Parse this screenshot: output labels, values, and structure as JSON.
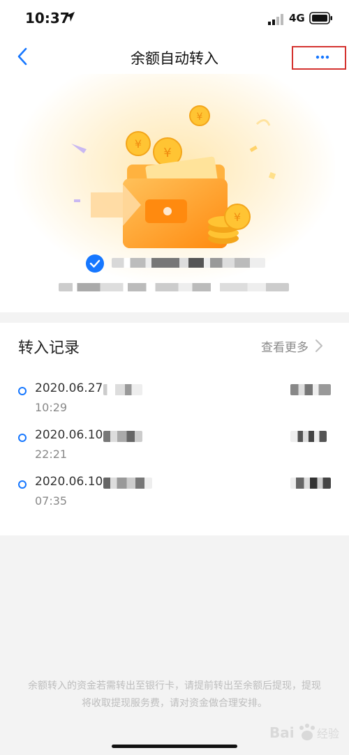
{
  "status_bar": {
    "time": "10:37",
    "network": "4G"
  },
  "nav": {
    "title": "余额自动转入",
    "back_icon": "chevron-left-icon",
    "more_icon": "more-horizontal-icon"
  },
  "records_section": {
    "title": "转入记录",
    "view_more": "查看更多",
    "items": [
      {
        "date": "2020.06.27",
        "time": "10:29"
      },
      {
        "date": "2020.06.10",
        "time": "22:21"
      },
      {
        "date": "2020.06.10",
        "time": "07:35"
      }
    ]
  },
  "notice": "余额转入的资金若需转出至银行卡，请提前转出至余额后提现，提现将收取提现服务费，请对资金做合理安排。",
  "watermark": {
    "text": "Bai 经验"
  },
  "colors": {
    "accent": "#1677ff",
    "annotation": "#d4322f",
    "wallet_orange": "#ff9d1c",
    "coin_gold": "#ffc433"
  }
}
